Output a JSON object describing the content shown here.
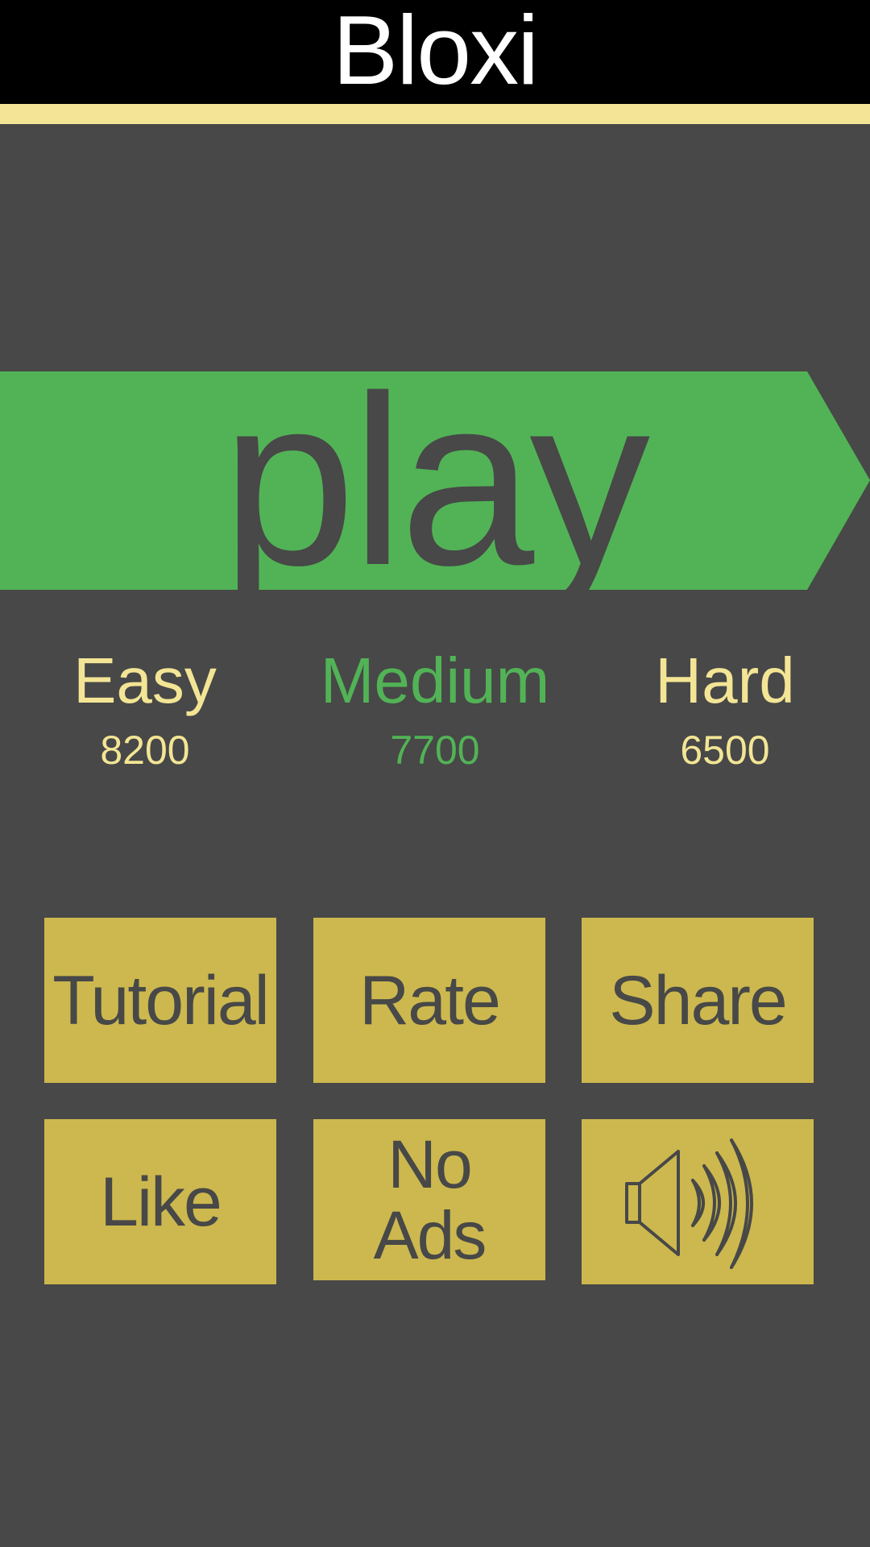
{
  "app": {
    "title": "Bloxi"
  },
  "play": {
    "label": "play"
  },
  "modes": [
    {
      "name": "Easy",
      "score": "8200",
      "selected": false
    },
    {
      "name": "Medium",
      "score": "7700",
      "selected": true
    },
    {
      "name": "Hard",
      "score": "6500",
      "selected": false
    }
  ],
  "tiles": {
    "tutorial": "Tutorial",
    "rate": "Rate",
    "share": "Share",
    "like": "Like",
    "no_ads": "No\nAds",
    "sound_icon": "speaker-volume-icon"
  },
  "colors": {
    "background": "#474847",
    "header": "#000000",
    "accent_bar": "#f3e595",
    "play_green": "#52b356",
    "tile_gold": "#ccb84e",
    "text_cream": "#f3e595",
    "selected_mode": "#52b356"
  }
}
